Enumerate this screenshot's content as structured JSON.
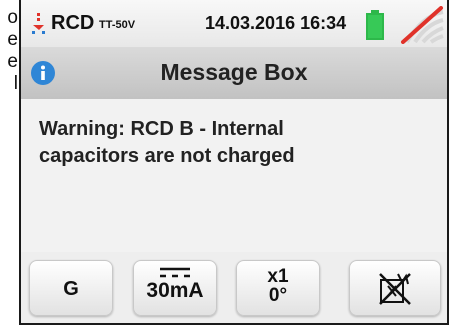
{
  "side_text": [
    "o",
    "e",
    "e",
    "l"
  ],
  "status_bar": {
    "rcd_label": "RCD",
    "rcd_sub": "TT-50V",
    "datetime": "14.03.2016 16:34",
    "battery_color": "#2db84a",
    "signal_slash_color": "#e0322a"
  },
  "message_box": {
    "title": "Message Box",
    "line1": "Warning: RCD B - Internal",
    "line2": "capacitors are not charged",
    "info_icon_color": "#2f86d6"
  },
  "keys": {
    "g_label": "G",
    "current_label": "30mA",
    "multiplier_label": "x1",
    "phase_label": "0°",
    "current_icon": "dc-current-icon",
    "autotest_icon": "crossed-out-autotest-icon"
  }
}
